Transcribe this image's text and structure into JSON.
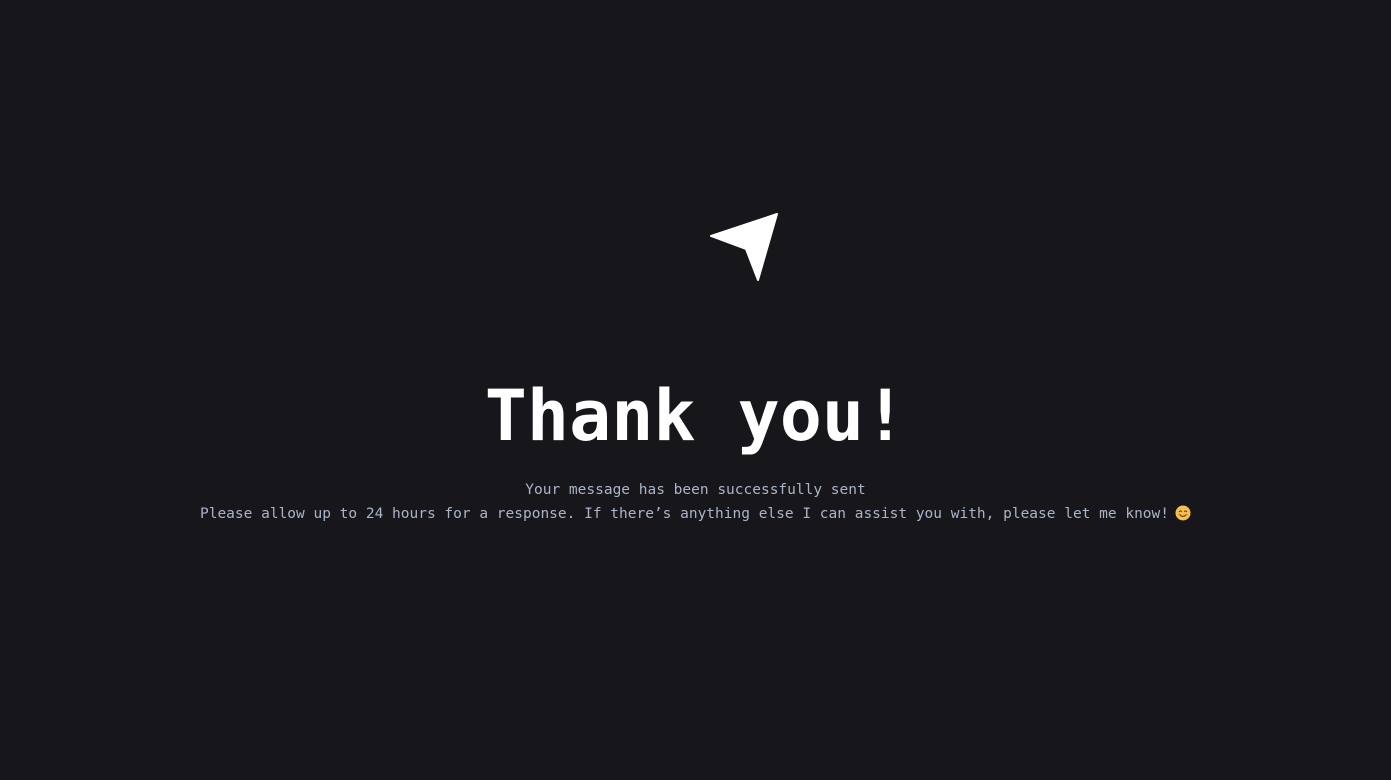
{
  "icon": "paper-plane-icon",
  "emoji_icon": "smiling-face-icon",
  "colors": {
    "background": "#17171b",
    "title": "#ffffff",
    "text": "#aab4c8",
    "emoji": "#f5c14b"
  },
  "heading": "Thank you!",
  "message": {
    "line1": "Your message has been successfully sent",
    "line2": "Please allow up to 24 hours for a response. If there’s anything else I can assist you with, please let me know!"
  }
}
